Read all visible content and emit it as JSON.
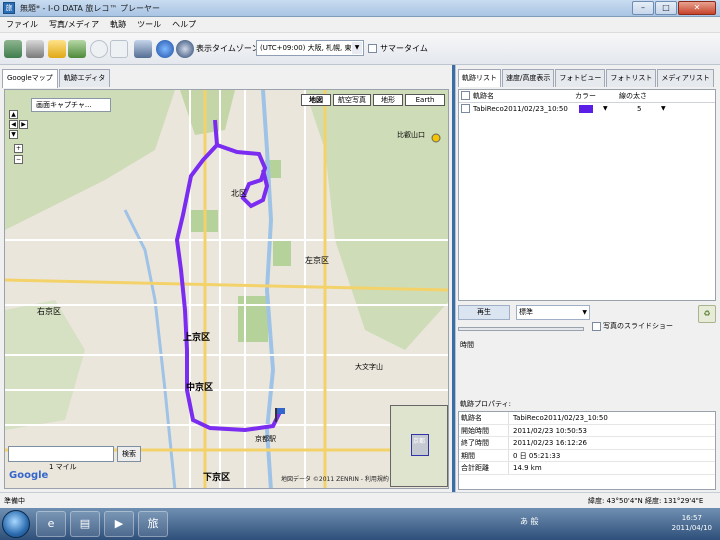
{
  "window": {
    "title": "無題* - I-O DATA 旅レコ™ プレーヤー",
    "app_icon_text": "旅",
    "buttons": {
      "minimize": "–",
      "maximize": "□",
      "close": "✕"
    }
  },
  "menu": [
    "ファイル",
    "写真/メディア",
    "軌跡",
    "ツール",
    "ヘルプ"
  ],
  "toolbar": {
    "icons": [
      "print-icon",
      "stamp-icon",
      "open-folder-icon",
      "import-photos-icon",
      "clock-icon",
      "photo-frame-icon",
      "search-icon",
      "globe-icon",
      "google-earth-icon"
    ],
    "timezone_label": "表示タイムゾーン:",
    "timezone_value": "(UTC+09:00) 大阪, 札幌, 東京",
    "summer_time_label": "サマータイム"
  },
  "left_tabs": [
    "Googleマップ",
    "軌跡エディタ"
  ],
  "map": {
    "capture_button": "画面キャプチャ...",
    "map_types": [
      "地図",
      "航空写真",
      "地形",
      "Earth"
    ],
    "search_button": "検索",
    "scale": "1 マイル",
    "google_logo": "Google",
    "copyright": "地図データ ©2011 ZENRIN - 利用規約",
    "minimap_label": "京都",
    "place_labels": {
      "kamigyo": "上京区",
      "nakagyo": "中京区",
      "shimogyo": "下京区",
      "kita_ward": "北区",
      "ukyo": "右京区",
      "sakyo": "左京区",
      "daimonji": "大文字山",
      "hieizan": "比叡山口",
      "kyoto_station": "京都駅"
    }
  },
  "right_tabs": [
    "軌跡リスト",
    "速度/高度表示",
    "フォトビュー",
    "フォトリスト",
    "メディアリスト"
  ],
  "track_list": {
    "headers": [
      "軌跡名",
      "カラー",
      "線の太さ"
    ],
    "rows": [
      {
        "name": "TabiReco2011/02/23_10:50",
        "color": "#5a1ee6",
        "width": "5"
      }
    ]
  },
  "playback": {
    "play_button": "再生",
    "speed": "標準",
    "slideshow_label": "写真のスライドショー",
    "time_label": "時間"
  },
  "properties": {
    "section_label": "軌跡プロパティ:",
    "rows": [
      {
        "key": "軌跡名",
        "value": "TabiReco2011/02/23_10:50"
      },
      {
        "key": "開始時間",
        "value": "2011/02/23 10:50:53"
      },
      {
        "key": "終了時間",
        "value": "2011/02/23 16:12:26"
      },
      {
        "key": "期間",
        "value": "0 日 05:21:33"
      },
      {
        "key": "合計距離",
        "value": "14.9 km"
      }
    ]
  },
  "status": {
    "text": "準備中",
    "coordinates": "緯度: 43°50'4\"N  経度: 131°29'4\"E"
  },
  "taskbar": {
    "apps": [
      "ie-icon",
      "explorer-icon",
      "media-player-icon",
      "tabireco-app-icon"
    ],
    "app_label": "旅",
    "tray_text": "あ 般",
    "time": "16:57",
    "date": "2011/04/10"
  },
  "colors": {
    "track": "#7a2cf0",
    "accent": "#3366cc"
  }
}
